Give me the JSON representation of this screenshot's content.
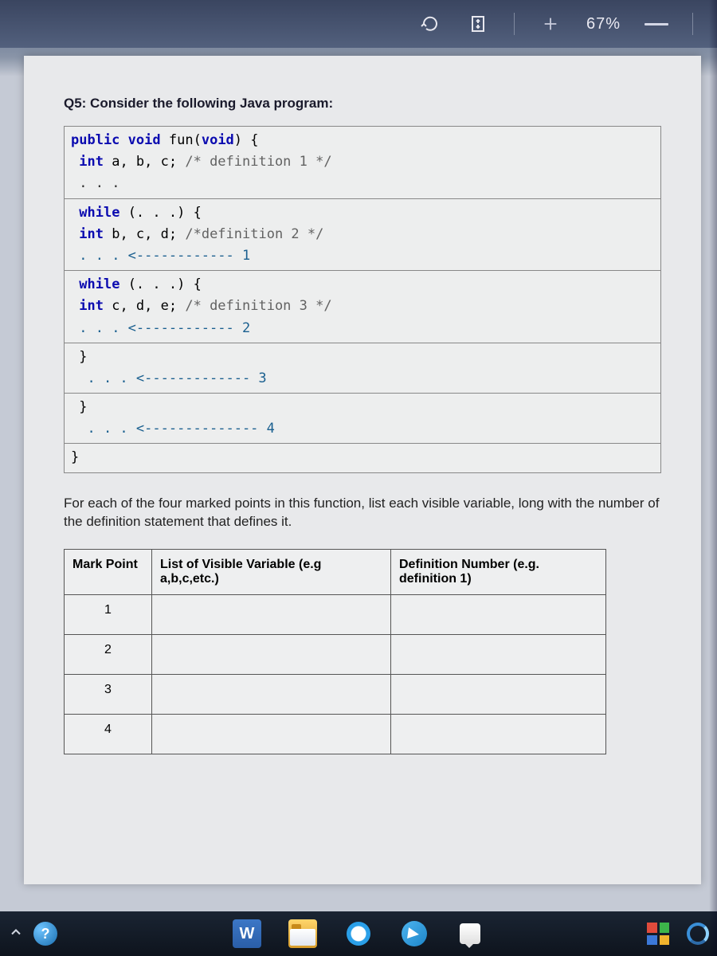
{
  "toolbar": {
    "zoom_label": "67%"
  },
  "question": {
    "title": "Q5: Consider the following Java program:",
    "code": {
      "sec1_l1_kw1": "public",
      "sec1_l1_kw2": "void",
      "sec1_l1_fn": "fun",
      "sec1_l1_kw3": "void",
      "sec1_l2_kw": "int",
      "sec1_l2_vars": "a, b, c;",
      "sec1_l2_cm": "/* definition 1 */",
      "sec1_l3_dots": ". . .",
      "sec2_l1_kw": "while",
      "sec2_l1_cond": "(. . .) {",
      "sec2_l2_kw": "int",
      "sec2_l2_vars": "b, c, d;",
      "sec2_l2_cm": "/*definition 2 */",
      "sec2_l3": ". . . <------------ 1",
      "sec3_l1_kw": "while",
      "sec3_l1_cond": "(. . .) {",
      "sec3_l2_kw": "int",
      "sec3_l2_vars": "c, d, e;",
      "sec3_l2_cm": "/* definition 3 */",
      "sec3_l3": ". . . <------------ 2",
      "sec4_l1": "}",
      "sec4_l2": ". . . <------------- 3",
      "sec5_l1": "}",
      "sec5_l2": ". . . <-------------- 4",
      "sec6_l1": "}"
    },
    "instruction": "For each of the four marked points in this function, list each visible variable, long with the number of the definition statement that defines it.",
    "table": {
      "h1": "Mark Point",
      "h2": "List of Visible Variable (e.g a,b,c,etc.)",
      "h3": "Definition Number (e.g. definition 1)",
      "rows": [
        "1",
        "2",
        "3",
        "4"
      ]
    }
  },
  "taskbar": {
    "word_label": "W",
    "help_label": "?"
  }
}
